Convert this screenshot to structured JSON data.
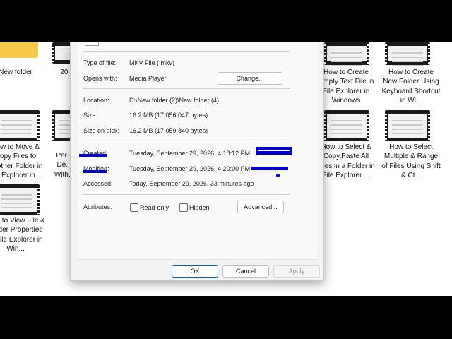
{
  "desktop": {
    "tiles_left": [
      {
        "label": "New folder"
      },
      {
        "label": "How to Move & Copy Files to Another Folder in File Explorer in ..."
      },
      {
        "label": "How to View File & Folder Properties in File Explorer in Win..."
      }
    ],
    "tiles_mid": [
      {
        "label": "20..."
      },
      {
        "label": "Per... De... With..."
      }
    ],
    "tiles_right1": [
      {
        "label": "How to Create Empty Text File in File Explorer in Windows"
      },
      {
        "label": "How to Select & Copy,Paste All Files in a Folder in File Explorer ..."
      }
    ],
    "tiles_right2": [
      {
        "label": "How to Create New Folder Using Keyboard Shortcut in Wi..."
      },
      {
        "label": "How to Select Multiple & Range of Files Using Shift & Ct..."
      }
    ]
  },
  "dialog": {
    "type_label": "Type of file:",
    "type_value": "MKV File (.mkv)",
    "opens_label": "Opens with:",
    "opens_value": "Media Player",
    "change_button": "Change...",
    "location_label": "Location:",
    "location_value": "D:\\New folder (2)\\New folder (4)",
    "size_label": "Size:",
    "size_value": "16.2 MB (17,056,047 bytes)",
    "size_on_disk_label": "Size on disk:",
    "size_on_disk_value": "16.2 MB (17,059,840 bytes)",
    "created_label": "Created:",
    "created_value": "Tuesday, September 29, 2026, 4:18:12 PM",
    "modified_label": "Modified:",
    "modified_value": "Tuesday, September 29, 2026, 4:20:00 PM",
    "accessed_label": "Accessed:",
    "accessed_value": "Today, September 29, 2026, 33 minutes ago",
    "attributes_label": "Attributes:",
    "readonly_label": "Read-only",
    "hidden_label": "Hidden",
    "advanced_button": "Advanced...",
    "ok_button": "OK",
    "cancel_button": "Cancel",
    "apply_button": "Apply"
  },
  "colors": {
    "annotation": "#0000cc",
    "folder": "#f6c94c",
    "accent": "#005fb8"
  }
}
